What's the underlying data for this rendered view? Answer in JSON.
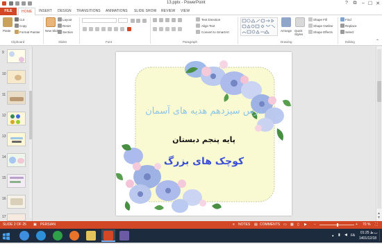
{
  "window": {
    "title": "13.pptx - PowerPoint",
    "controls": [
      "?",
      "⧉",
      "–",
      "☐",
      "✕"
    ]
  },
  "ribbon_tabs": [
    "FILE",
    "HOME",
    "INSERT",
    "DESIGN",
    "TRANSITIONS",
    "ANIMATIONS",
    "SLIDE SHOW",
    "REVIEW",
    "VIEW"
  ],
  "ribbon": {
    "clipboard": {
      "label": "Clipboard",
      "paste": "Paste",
      "cut": "Cut",
      "copy": "Copy",
      "format_painter": "Format Painter"
    },
    "slides": {
      "label": "Slides",
      "new_slide": "New Slide",
      "layout": "Layout",
      "reset": "Reset",
      "section": "Section"
    },
    "font": {
      "label": "Font"
    },
    "paragraph": {
      "label": "Paragraph",
      "text_direction": "Text Direction",
      "align_text": "Align Text",
      "convert_smartart": "Convert to SmartArt"
    },
    "drawing": {
      "label": "Drawing",
      "arrange": "Arrange",
      "quick_styles": "Quick Styles",
      "shape_fill": "Shape Fill",
      "shape_outline": "Shape Outline",
      "shape_effects": "Shape Effects"
    },
    "editing": {
      "label": "Editing",
      "find": "Find",
      "replace": "Replace",
      "select": "Select"
    }
  },
  "thumbnails": [
    {
      "num": "9"
    },
    {
      "num": "10"
    },
    {
      "num": "11"
    },
    {
      "num": "12"
    },
    {
      "num": "13"
    },
    {
      "num": "14"
    },
    {
      "num": "15"
    },
    {
      "num": "16"
    },
    {
      "num": "17"
    }
  ],
  "slide": {
    "title": "درس سیزدهم هدیه های آسمان",
    "subtitle": "پایه پنجم دبستان",
    "lesson": "کوچک های بزرگ"
  },
  "status": {
    "slide_info": "SLIDE 2 OF 25",
    "language": "PERSIAN",
    "notes": "NOTES",
    "comments": "COMMENTS",
    "zoom": "70 %"
  },
  "taskbar": {
    "lang": "FA",
    "time": "01:25 ب.ظ",
    "date": "1401/12/18"
  },
  "colors": {
    "accent": "#d24726",
    "slide_frame": "#fafad2",
    "title_color": "#8ec5e6",
    "subtitle_color": "#111111",
    "lesson_color": "#3a4fd6",
    "taskbar": "#1c2b3d"
  }
}
